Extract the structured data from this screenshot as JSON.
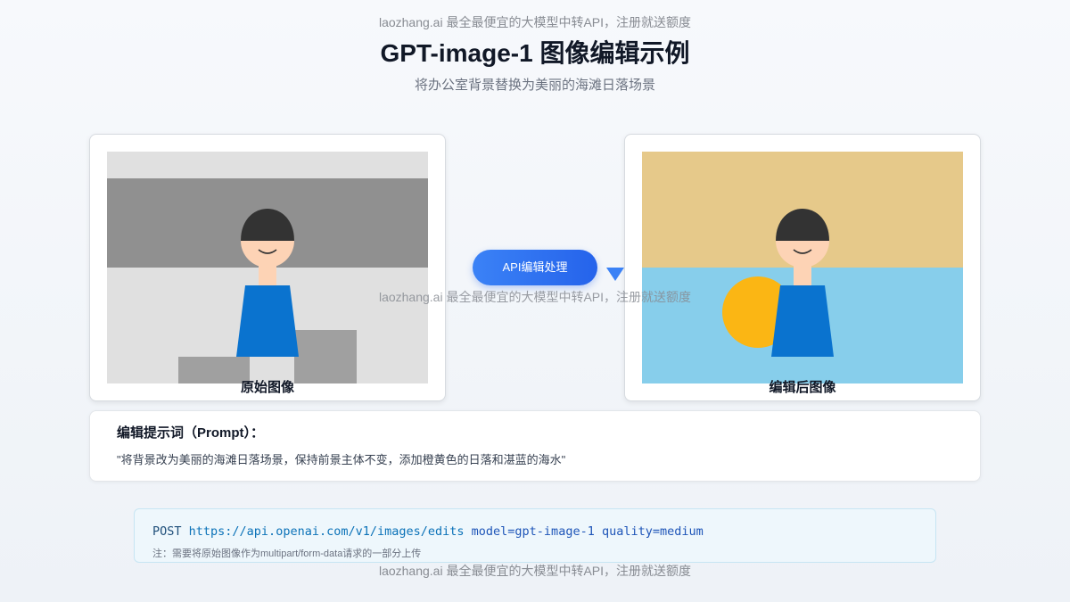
{
  "watermark": {
    "text": "laozhang.ai 最全最便宜的大模型中转API，注册就送额度"
  },
  "header": {
    "title": "GPT-image-1 图像编辑示例",
    "subtitle": "将办公室背景替换为美丽的海滩日落场景"
  },
  "original_card": {
    "label": "原始图像"
  },
  "edited_card": {
    "label": "编辑后图像"
  },
  "process": {
    "button_label": "API编辑处理",
    "arrow_icon": "arrow-down-triangle-icon"
  },
  "prompt": {
    "heading": "编辑提示词（Prompt）：",
    "text": "\"将背景改为美丽的海滩日落场景，保持前景主体不变，添加橙黄色的日落和湛蓝的海水\""
  },
  "code": {
    "method": "POST",
    "url": "https://api.openai.com/v1/images/edits",
    "params": "model=gpt-image-1 quality=medium",
    "note": "注：需要将原始图像作为multipart/form-data请求的一部分上传"
  },
  "colors": {
    "accent": "#3b82f6",
    "office_wall": "#e0e0e0",
    "office_band": "#909090",
    "office_furniture": "#a0a0a0",
    "sunset_sky": "#e6c98a",
    "sea": "#87ceeb",
    "sun": "#fbb614",
    "shirt": "#0a73cf",
    "hair": "#333333",
    "skin": "#fdd3b5"
  }
}
